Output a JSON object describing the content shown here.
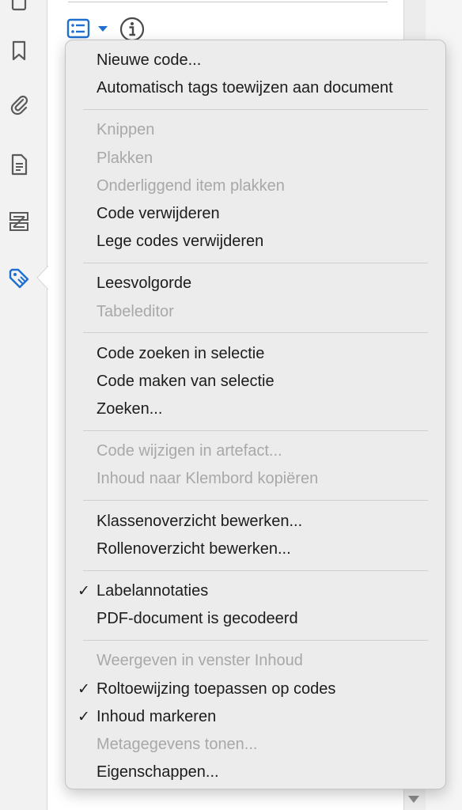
{
  "sidebar": {
    "icons": [
      "page-icon",
      "bookmark-icon",
      "paperclip-icon",
      "document-icon",
      "layers-icon",
      "tag-icon"
    ]
  },
  "toolbar": {
    "options_icon": "list-options-icon",
    "info_icon": "info-icon"
  },
  "colors": {
    "accent": "#1f6fd0",
    "menu_bg": "#ececec",
    "text": "#1c1c1c",
    "disabled_text": "#a8a8a8"
  },
  "menu": {
    "groups": [
      [
        {
          "label": "Nieuwe code...",
          "enabled": true,
          "checked": false
        },
        {
          "label": "Automatisch tags toewijzen aan document",
          "enabled": true,
          "checked": false
        }
      ],
      [
        {
          "label": "Knippen",
          "enabled": false,
          "checked": false
        },
        {
          "label": "Plakken",
          "enabled": false,
          "checked": false
        },
        {
          "label": "Onderliggend item plakken",
          "enabled": false,
          "checked": false
        },
        {
          "label": "Code verwijderen",
          "enabled": true,
          "checked": false
        },
        {
          "label": "Lege codes verwijderen",
          "enabled": true,
          "checked": false
        }
      ],
      [
        {
          "label": "Leesvolgorde",
          "enabled": true,
          "checked": false
        },
        {
          "label": "Tabeleditor",
          "enabled": false,
          "checked": false
        }
      ],
      [
        {
          "label": "Code zoeken in selectie",
          "enabled": true,
          "checked": false
        },
        {
          "label": "Code maken van selectie",
          "enabled": true,
          "checked": false
        },
        {
          "label": "Zoeken...",
          "enabled": true,
          "checked": false
        }
      ],
      [
        {
          "label": "Code wijzigen in artefact...",
          "enabled": false,
          "checked": false
        },
        {
          "label": "Inhoud naar Klembord kopiëren",
          "enabled": false,
          "checked": false
        }
      ],
      [
        {
          "label": "Klassenoverzicht bewerken...",
          "enabled": true,
          "checked": false
        },
        {
          "label": "Rollenoverzicht bewerken...",
          "enabled": true,
          "checked": false
        }
      ],
      [
        {
          "label": "Labelannotaties",
          "enabled": true,
          "checked": true
        },
        {
          "label": "PDF-document is gecodeerd",
          "enabled": true,
          "checked": false
        }
      ],
      [
        {
          "label": "Weergeven in venster Inhoud",
          "enabled": false,
          "checked": false
        },
        {
          "label": "Roltoewijzing toepassen op codes",
          "enabled": true,
          "checked": true
        },
        {
          "label": "Inhoud markeren",
          "enabled": true,
          "checked": true
        },
        {
          "label": "Metagegevens tonen...",
          "enabled": false,
          "checked": false
        },
        {
          "label": "Eigenschappen...",
          "enabled": true,
          "checked": false
        }
      ]
    ],
    "check_glyph": "✓"
  }
}
